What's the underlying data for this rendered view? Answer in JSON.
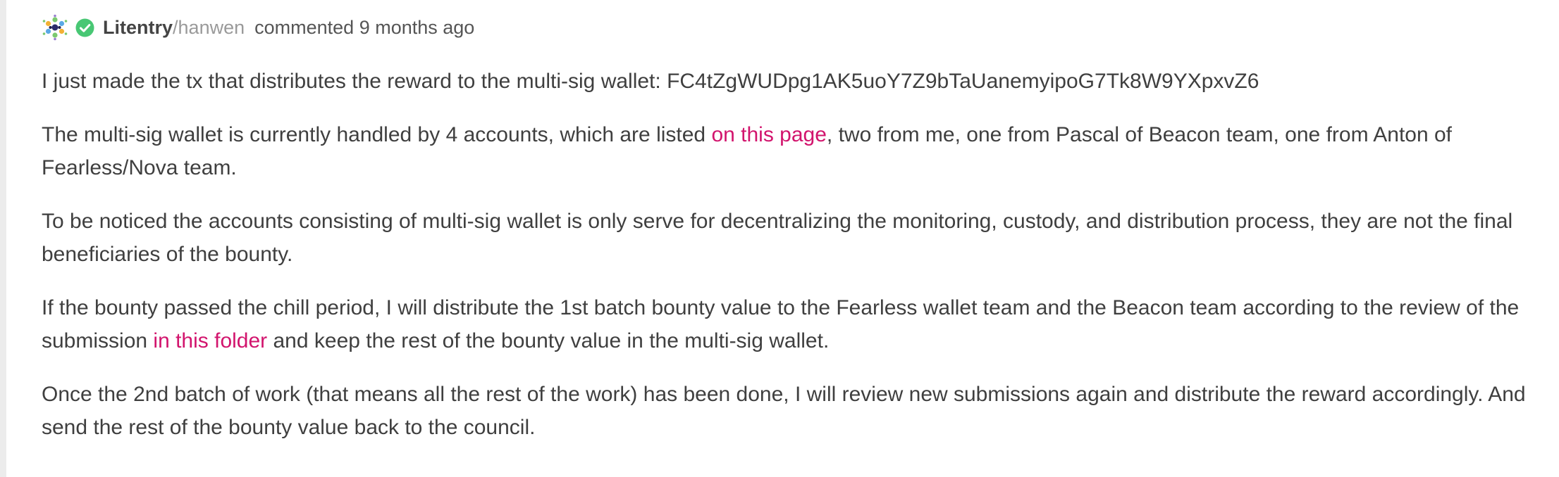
{
  "comment": {
    "author": {
      "name": "Litentry",
      "separator": "/",
      "handle": "hanwen"
    },
    "meta": "commented 9 months ago",
    "paragraphs": [
      {
        "text": "I just made the tx that distributes the reward to the multi-sig wallet: FC4tZgWUDpg1AK5uoY7Z9bTaUanemyipoG7Tk8W9YXpxvZ6"
      },
      {
        "before": "The multi-sig wallet is currently handled by 4 accounts, which are listed ",
        "link": "on this page",
        "after": ", two from me, one from Pascal of Beacon team, one from Anton of Fearless/Nova team."
      },
      {
        "text": "To be noticed the accounts consisting of multi-sig wallet is only serve for decentralizing the monitoring, custody, and distribution process, they are not the final beneficiaries of the bounty."
      },
      {
        "before": "If the bounty passed the chill period, I will distribute the 1st batch bounty value to the Fearless wallet team and the Beacon team according to the review of the submission ",
        "link": "in this folder",
        "after": " and keep the rest of the bounty value in the multi-sig wallet."
      },
      {
        "text": "Once the 2nd batch of work (that means all the rest of the work) has been done, I will review new submissions again and distribute the reward accordingly. And send the rest of the bounty value back to the council."
      }
    ]
  },
  "icons": {
    "avatar": "litentry-logo-icon",
    "verified": "verified-check-icon"
  },
  "colors": {
    "link": "#d2146d",
    "verified": "#48c774",
    "text": "#3f3f3f",
    "muted": "#9a9a9a",
    "left_border": "#ececec"
  }
}
